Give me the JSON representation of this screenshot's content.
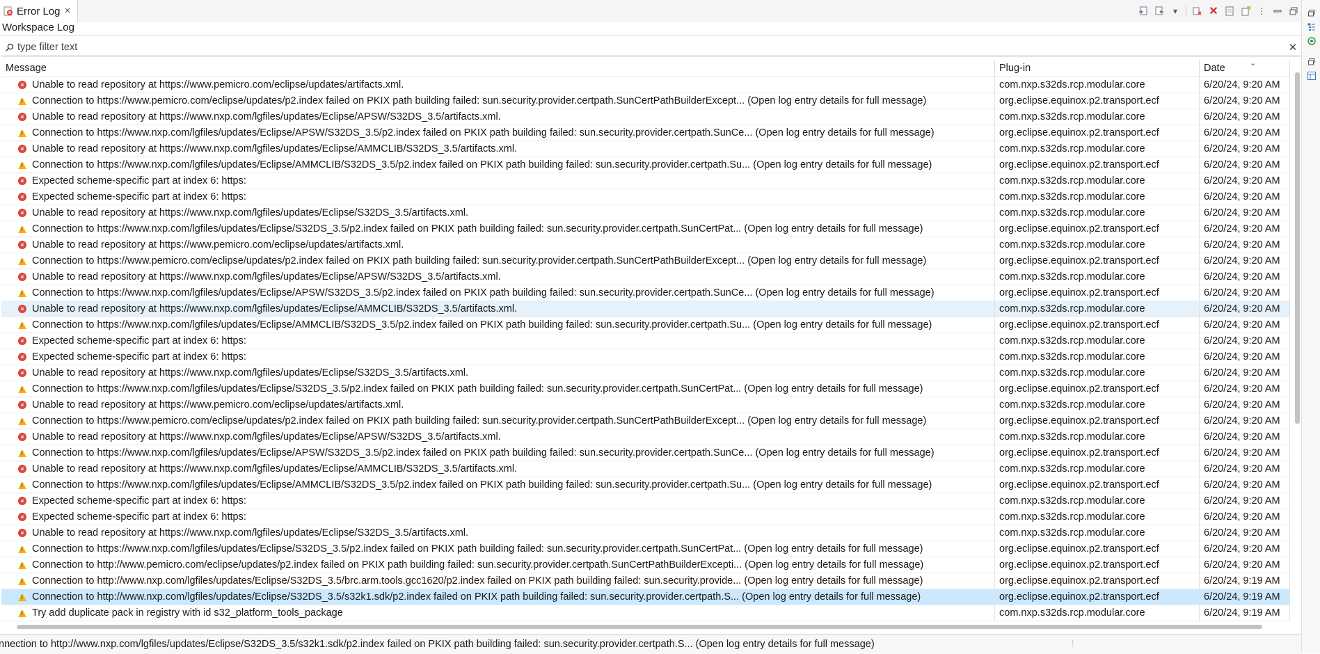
{
  "tab": {
    "title": "Error Log",
    "close": "✕"
  },
  "subtitle": "Workspace Log",
  "filter": {
    "placeholder": "type filter text",
    "clear": "✕"
  },
  "toolbar": {
    "icons": [
      "export-log-icon",
      "import-log-icon",
      "dropdown-icon",
      "clear-log-icon",
      "delete-log-icon",
      "open-log-icon",
      "restore-log-icon",
      "view-menu-icon",
      "minimize-icon",
      "maximize-icon"
    ]
  },
  "table": {
    "columns": [
      "Message",
      "Plug-in",
      "Date"
    ],
    "rows": [
      {
        "severity": "error",
        "message": "Unable to read repository at https://www.pemicro.com/eclipse/updates/artifacts.xml.",
        "plugin": "com.nxp.s32ds.rcp.modular.core",
        "date": "6/20/24, 9:20 AM"
      },
      {
        "severity": "warning",
        "message": "Connection to https://www.pemicro.com/eclipse/updates/p2.index failed on PKIX path building failed: sun.security.provider.certpath.SunCertPathBuilderExcept... (Open log entry details for full message)",
        "plugin": "org.eclipse.equinox.p2.transport.ecf",
        "date": "6/20/24, 9:20 AM"
      },
      {
        "severity": "error",
        "message": "Unable to read repository at https://www.nxp.com/lgfiles/updates/Eclipse/APSW/S32DS_3.5/artifacts.xml.",
        "plugin": "com.nxp.s32ds.rcp.modular.core",
        "date": "6/20/24, 9:20 AM"
      },
      {
        "severity": "warning",
        "message": "Connection to https://www.nxp.com/lgfiles/updates/Eclipse/APSW/S32DS_3.5/p2.index failed on PKIX path building failed: sun.security.provider.certpath.SunCe... (Open log entry details for full message)",
        "plugin": "org.eclipse.equinox.p2.transport.ecf",
        "date": "6/20/24, 9:20 AM"
      },
      {
        "severity": "error",
        "message": "Unable to read repository at https://www.nxp.com/lgfiles/updates/Eclipse/AMMCLIB/S32DS_3.5/artifacts.xml.",
        "plugin": "com.nxp.s32ds.rcp.modular.core",
        "date": "6/20/24, 9:20 AM"
      },
      {
        "severity": "warning",
        "message": "Connection to https://www.nxp.com/lgfiles/updates/Eclipse/AMMCLIB/S32DS_3.5/p2.index failed on PKIX path building failed: sun.security.provider.certpath.Su... (Open log entry details for full message)",
        "plugin": "org.eclipse.equinox.p2.transport.ecf",
        "date": "6/20/24, 9:20 AM"
      },
      {
        "severity": "error",
        "message": "Expected scheme-specific part at index 6: https:",
        "plugin": "com.nxp.s32ds.rcp.modular.core",
        "date": "6/20/24, 9:20 AM"
      },
      {
        "severity": "error",
        "message": "Expected scheme-specific part at index 6: https:",
        "plugin": "com.nxp.s32ds.rcp.modular.core",
        "date": "6/20/24, 9:20 AM"
      },
      {
        "severity": "error",
        "message": "Unable to read repository at https://www.nxp.com/lgfiles/updates/Eclipse/S32DS_3.5/artifacts.xml.",
        "plugin": "com.nxp.s32ds.rcp.modular.core",
        "date": "6/20/24, 9:20 AM"
      },
      {
        "severity": "warning",
        "message": "Connection to https://www.nxp.com/lgfiles/updates/Eclipse/S32DS_3.5/p2.index failed on PKIX path building failed: sun.security.provider.certpath.SunCertPat... (Open log entry details for full message)",
        "plugin": "org.eclipse.equinox.p2.transport.ecf",
        "date": "6/20/24, 9:20 AM"
      },
      {
        "severity": "error",
        "message": "Unable to read repository at https://www.pemicro.com/eclipse/updates/artifacts.xml.",
        "plugin": "com.nxp.s32ds.rcp.modular.core",
        "date": "6/20/24, 9:20 AM"
      },
      {
        "severity": "warning",
        "message": "Connection to https://www.pemicro.com/eclipse/updates/p2.index failed on PKIX path building failed: sun.security.provider.certpath.SunCertPathBuilderExcept... (Open log entry details for full message)",
        "plugin": "org.eclipse.equinox.p2.transport.ecf",
        "date": "6/20/24, 9:20 AM"
      },
      {
        "severity": "error",
        "message": "Unable to read repository at https://www.nxp.com/lgfiles/updates/Eclipse/APSW/S32DS_3.5/artifacts.xml.",
        "plugin": "com.nxp.s32ds.rcp.modular.core",
        "date": "6/20/24, 9:20 AM"
      },
      {
        "severity": "warning",
        "message": "Connection to https://www.nxp.com/lgfiles/updates/Eclipse/APSW/S32DS_3.5/p2.index failed on PKIX path building failed: sun.security.provider.certpath.SunCe... (Open log entry details for full message)",
        "plugin": "org.eclipse.equinox.p2.transport.ecf",
        "date": "6/20/24, 9:20 AM"
      },
      {
        "severity": "error",
        "message": "Unable to read repository at https://www.nxp.com/lgfiles/updates/Eclipse/AMMCLIB/S32DS_3.5/artifacts.xml.",
        "plugin": "com.nxp.s32ds.rcp.modular.core",
        "date": "6/20/24, 9:20 AM",
        "highlight": "hover"
      },
      {
        "severity": "warning",
        "message": "Connection to https://www.nxp.com/lgfiles/updates/Eclipse/AMMCLIB/S32DS_3.5/p2.index failed on PKIX path building failed: sun.security.provider.certpath.Su... (Open log entry details for full message)",
        "plugin": "org.eclipse.equinox.p2.transport.ecf",
        "date": "6/20/24, 9:20 AM"
      },
      {
        "severity": "error",
        "message": "Expected scheme-specific part at index 6: https:",
        "plugin": "com.nxp.s32ds.rcp.modular.core",
        "date": "6/20/24, 9:20 AM"
      },
      {
        "severity": "error",
        "message": "Expected scheme-specific part at index 6: https:",
        "plugin": "com.nxp.s32ds.rcp.modular.core",
        "date": "6/20/24, 9:20 AM"
      },
      {
        "severity": "error",
        "message": "Unable to read repository at https://www.nxp.com/lgfiles/updates/Eclipse/S32DS_3.5/artifacts.xml.",
        "plugin": "com.nxp.s32ds.rcp.modular.core",
        "date": "6/20/24, 9:20 AM"
      },
      {
        "severity": "warning",
        "message": "Connection to https://www.nxp.com/lgfiles/updates/Eclipse/S32DS_3.5/p2.index failed on PKIX path building failed: sun.security.provider.certpath.SunCertPat... (Open log entry details for full message)",
        "plugin": "org.eclipse.equinox.p2.transport.ecf",
        "date": "6/20/24, 9:20 AM"
      },
      {
        "severity": "error",
        "message": "Unable to read repository at https://www.pemicro.com/eclipse/updates/artifacts.xml.",
        "plugin": "com.nxp.s32ds.rcp.modular.core",
        "date": "6/20/24, 9:20 AM"
      },
      {
        "severity": "warning",
        "message": "Connection to https://www.pemicro.com/eclipse/updates/p2.index failed on PKIX path building failed: sun.security.provider.certpath.SunCertPathBuilderExcept... (Open log entry details for full message)",
        "plugin": "org.eclipse.equinox.p2.transport.ecf",
        "date": "6/20/24, 9:20 AM"
      },
      {
        "severity": "error",
        "message": "Unable to read repository at https://www.nxp.com/lgfiles/updates/Eclipse/APSW/S32DS_3.5/artifacts.xml.",
        "plugin": "com.nxp.s32ds.rcp.modular.core",
        "date": "6/20/24, 9:20 AM"
      },
      {
        "severity": "warning",
        "message": "Connection to https://www.nxp.com/lgfiles/updates/Eclipse/APSW/S32DS_3.5/p2.index failed on PKIX path building failed: sun.security.provider.certpath.SunCe... (Open log entry details for full message)",
        "plugin": "org.eclipse.equinox.p2.transport.ecf",
        "date": "6/20/24, 9:20 AM"
      },
      {
        "severity": "error",
        "message": "Unable to read repository at https://www.nxp.com/lgfiles/updates/Eclipse/AMMCLIB/S32DS_3.5/artifacts.xml.",
        "plugin": "com.nxp.s32ds.rcp.modular.core",
        "date": "6/20/24, 9:20 AM"
      },
      {
        "severity": "warning",
        "message": "Connection to https://www.nxp.com/lgfiles/updates/Eclipse/AMMCLIB/S32DS_3.5/p2.index failed on PKIX path building failed: sun.security.provider.certpath.Su... (Open log entry details for full message)",
        "plugin": "org.eclipse.equinox.p2.transport.ecf",
        "date": "6/20/24, 9:20 AM"
      },
      {
        "severity": "error",
        "message": "Expected scheme-specific part at index 6: https:",
        "plugin": "com.nxp.s32ds.rcp.modular.core",
        "date": "6/20/24, 9:20 AM"
      },
      {
        "severity": "error",
        "message": "Expected scheme-specific part at index 6: https:",
        "plugin": "com.nxp.s32ds.rcp.modular.core",
        "date": "6/20/24, 9:20 AM"
      },
      {
        "severity": "error",
        "message": "Unable to read repository at https://www.nxp.com/lgfiles/updates/Eclipse/S32DS_3.5/artifacts.xml.",
        "plugin": "com.nxp.s32ds.rcp.modular.core",
        "date": "6/20/24, 9:20 AM"
      },
      {
        "severity": "warning",
        "message": "Connection to https://www.nxp.com/lgfiles/updates/Eclipse/S32DS_3.5/p2.index failed on PKIX path building failed: sun.security.provider.certpath.SunCertPat... (Open log entry details for full message)",
        "plugin": "org.eclipse.equinox.p2.transport.ecf",
        "date": "6/20/24, 9:20 AM"
      },
      {
        "severity": "warning",
        "message": "Connection to http://www.pemicro.com/eclipse/updates/p2.index failed on PKIX path building failed: sun.security.provider.certpath.SunCertPathBuilderExcepti... (Open log entry details for full message)",
        "plugin": "org.eclipse.equinox.p2.transport.ecf",
        "date": "6/20/24, 9:20 AM"
      },
      {
        "severity": "warning",
        "message": "Connection to http://www.nxp.com/lgfiles/updates/Eclipse/S32DS_3.5/brc.arm.tools.gcc1620/p2.index failed on PKIX path building failed: sun.security.provide... (Open log entry details for full message)",
        "plugin": "org.eclipse.equinox.p2.transport.ecf",
        "date": "6/20/24, 9:19 AM"
      },
      {
        "severity": "warning",
        "message": "Connection to http://www.nxp.com/lgfiles/updates/Eclipse/S32DS_3.5/s32k1.sdk/p2.index failed on PKIX path building failed: sun.security.provider.certpath.S... (Open log entry details for full message)",
        "plugin": "org.eclipse.equinox.p2.transport.ecf",
        "date": "6/20/24, 9:19 AM",
        "highlight": "selected"
      },
      {
        "severity": "warning",
        "message": "Try add duplicate pack in registry with id s32_platform_tools_package",
        "plugin": "com.nxp.s32ds.rcp.modular.core",
        "date": "6/20/24, 9:19 AM"
      }
    ]
  },
  "status": {
    "text": "nnection to http://www.nxp.com/lgfiles/updates/Eclipse/S32DS_3.5/s32k1.sdk/p2.index failed on PKIX path building failed: sun.security.provider.certpath.S... (Open log entry details for full message)"
  }
}
